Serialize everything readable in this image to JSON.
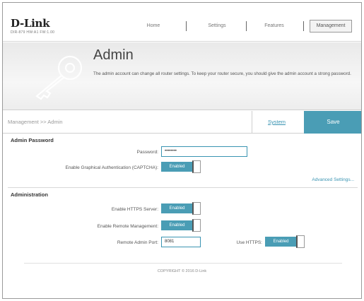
{
  "brand": {
    "name": "D-Link",
    "model": "DIR-879 HW:A1 FW:1.00"
  },
  "nav": {
    "home": "Home",
    "settings": "Settings",
    "features": "Features",
    "management": "Management"
  },
  "banner": {
    "title": "Admin",
    "description": "The admin account can change all router settings. To keep your router secure, you should give the admin account a strong password."
  },
  "toolbar": {
    "breadcrumb": "Management >> Admin",
    "system": "System",
    "save": "Save"
  },
  "admin_password": {
    "title": "Admin Password",
    "password_label": "Password:",
    "password_value": "••••••••",
    "captcha_label": "Enable Graphical Authentication (CAPTCHA):",
    "captcha_state": "Enabled"
  },
  "advanced_link": "Advanced Settings...",
  "administration": {
    "title": "Administration",
    "https_label": "Enable HTTPS Server:",
    "https_state": "Enabled",
    "remote_label": "Enable Remote Management:",
    "remote_state": "Enabled",
    "port_label": "Remote Admin Port:",
    "port_value": "8081",
    "use_https_label": "Use HTTPS:",
    "use_https_state": "Enabled"
  },
  "footer": {
    "copyright": "COPYRIGHT © 2016 D-Link"
  },
  "colors": {
    "accent": "#4a9db5",
    "link": "#3a94b2"
  }
}
